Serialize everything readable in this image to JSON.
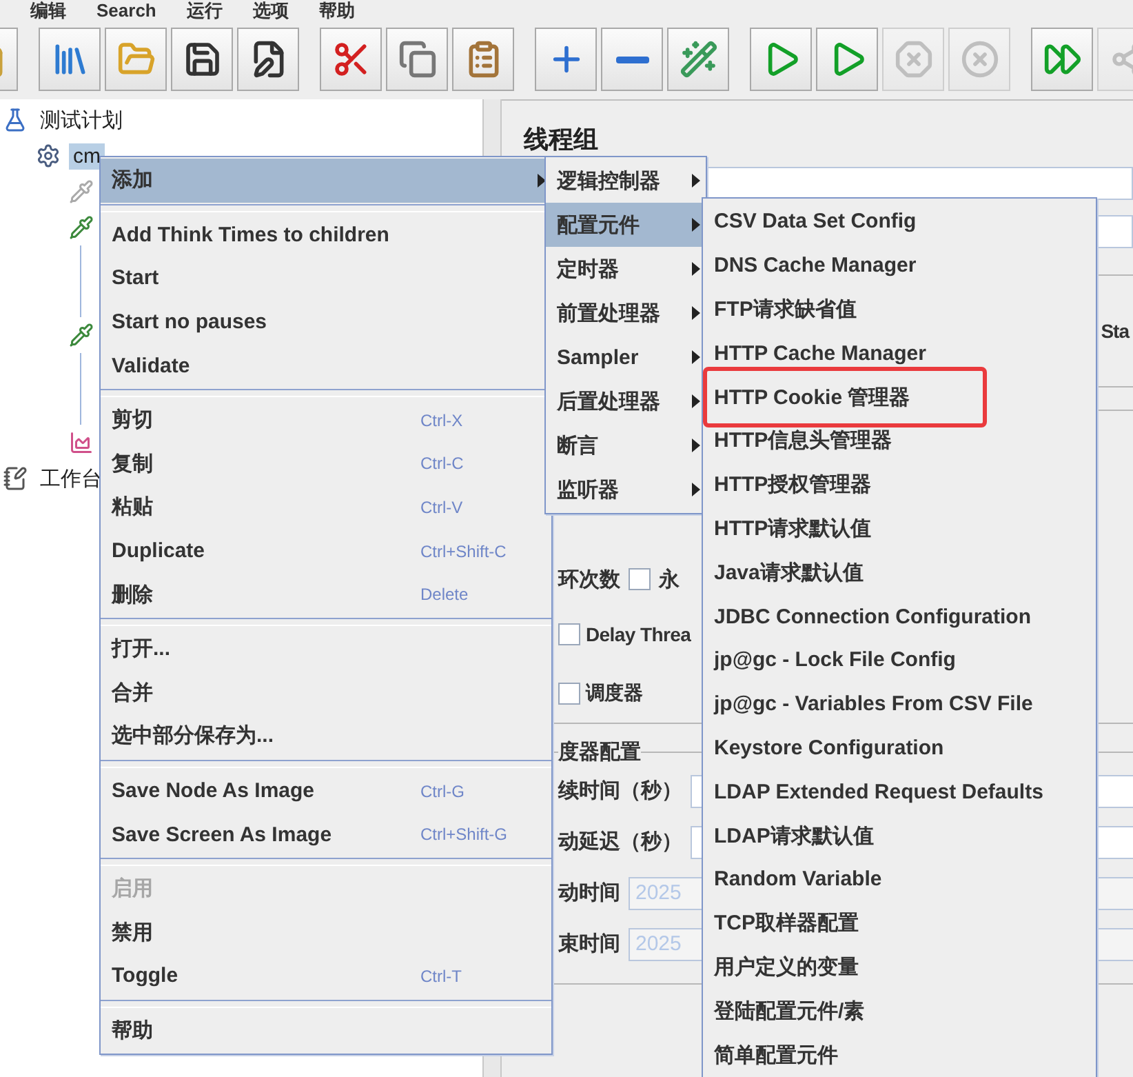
{
  "menubar": [
    "编辑",
    "Search",
    "运行",
    "选项",
    "帮助"
  ],
  "toolbar": [
    [
      {
        "kind": "new",
        "disabled": false
      }
    ],
    [
      {
        "kind": "templates",
        "disabled": false
      },
      {
        "kind": "open",
        "disabled": false
      },
      {
        "kind": "save",
        "disabled": false
      },
      {
        "kind": "save-as",
        "disabled": false
      }
    ],
    [
      {
        "kind": "cut",
        "disabled": false
      },
      {
        "kind": "copy",
        "disabled": false
      },
      {
        "kind": "paste",
        "disabled": false
      }
    ],
    [
      {
        "kind": "expand",
        "disabled": false
      },
      {
        "kind": "collapse",
        "disabled": false
      },
      {
        "kind": "toggle",
        "disabled": false
      }
    ],
    [
      {
        "kind": "start",
        "disabled": false
      },
      {
        "kind": "start-no-pause",
        "disabled": false
      },
      {
        "kind": "stop",
        "disabled": true
      },
      {
        "kind": "shutdown",
        "disabled": true
      }
    ],
    [
      {
        "kind": "remote-start",
        "disabled": false
      },
      {
        "kind": "remote",
        "disabled": true
      }
    ]
  ],
  "tree": [
    {
      "kind": "plan",
      "label": "测试计划",
      "selected": false,
      "children": [
        {
          "kind": "thread-group",
          "label": "cm",
          "selected": true,
          "children": [
            {
              "kind": "sampler",
              "enabled": false
            },
            {
              "kind": "sampler",
              "enabled": true,
              "expanded": true
            },
            {
              "kind": "sampler",
              "enabled": true,
              "expanded": true
            },
            {
              "kind": "listener",
              "enabled": true
            }
          ]
        }
      ]
    },
    {
      "kind": "workbench",
      "label": "工作台",
      "selected": false
    }
  ],
  "panel": {
    "title": "线程组",
    "error_action": "Sta",
    "loop": {
      "label": "环次数",
      "checked": false,
      "forever": "永"
    },
    "options": [
      {
        "label": "Delay Threa",
        "checked": false
      },
      {
        "label": "调度器",
        "checked": false
      }
    ],
    "scheduler": {
      "title": "度器配置",
      "fields": [
        {
          "label": "续时间（秒）"
        },
        {
          "label": "动延迟（秒）"
        },
        {
          "label": "动时间",
          "value": "2025"
        },
        {
          "label": "束时间",
          "value": "2025"
        }
      ]
    }
  },
  "context_menu": [
    [
      {
        "label": "添加",
        "submenu": true,
        "selected": true,
        "disabled": false
      }
    ],
    [
      {
        "label": "Add Think Times to children",
        "selected": false,
        "disabled": false
      },
      {
        "label": "Start",
        "selected": false,
        "disabled": false
      },
      {
        "label": "Start no pauses",
        "selected": false,
        "disabled": false
      },
      {
        "label": "Validate",
        "selected": false,
        "disabled": false
      }
    ],
    [
      {
        "label": "剪切",
        "shortcut": "Ctrl-X",
        "selected": false,
        "disabled": false
      },
      {
        "label": "复制",
        "shortcut": "Ctrl-C",
        "selected": false,
        "disabled": false
      },
      {
        "label": "粘贴",
        "shortcut": "Ctrl-V",
        "selected": false,
        "disabled": false
      },
      {
        "label": "Duplicate",
        "shortcut": "Ctrl+Shift-C",
        "selected": false,
        "disabled": false
      },
      {
        "label": "删除",
        "shortcut": "Delete",
        "selected": false,
        "disabled": false
      }
    ],
    [
      {
        "label": "打开...",
        "selected": false,
        "disabled": false
      },
      {
        "label": "合并",
        "selected": false,
        "disabled": false
      },
      {
        "label": "选中部分保存为...",
        "selected": false,
        "disabled": false
      }
    ],
    [
      {
        "label": "Save Node As Image",
        "shortcut": "Ctrl-G",
        "selected": false,
        "disabled": false
      },
      {
        "label": "Save Screen As Image",
        "shortcut": "Ctrl+Shift-G",
        "selected": false,
        "disabled": false
      }
    ],
    [
      {
        "label": "启用",
        "selected": false,
        "disabled": true
      },
      {
        "label": "禁用",
        "selected": false,
        "disabled": false
      },
      {
        "label": "Toggle",
        "shortcut": "Ctrl-T",
        "selected": false,
        "disabled": false
      }
    ],
    [
      {
        "label": "帮助",
        "selected": false,
        "disabled": false
      }
    ]
  ],
  "add_submenu": [
    {
      "label": "逻辑控制器",
      "selected": false
    },
    {
      "label": "配置元件",
      "selected": true
    },
    {
      "label": "定时器",
      "selected": false
    },
    {
      "label": "前置处理器",
      "selected": false
    },
    {
      "label": "Sampler",
      "selected": false
    },
    {
      "label": "后置处理器",
      "selected": false
    },
    {
      "label": "断言",
      "selected": false
    },
    {
      "label": "监听器",
      "selected": false
    }
  ],
  "config_submenu": [
    {
      "label": "CSV Data Set Config",
      "annotated": false
    },
    {
      "label": "DNS Cache Manager",
      "annotated": false
    },
    {
      "label": "FTP请求缺省值",
      "annotated": false
    },
    {
      "label": "HTTP Cache Manager",
      "annotated": false
    },
    {
      "label": "HTTP Cookie 管理器",
      "annotated": true
    },
    {
      "label": "HTTP信息头管理器",
      "annotated": false
    },
    {
      "label": "HTTP授权管理器",
      "annotated": false
    },
    {
      "label": "HTTP请求默认值",
      "annotated": false
    },
    {
      "label": "Java请求默认值",
      "annotated": false
    },
    {
      "label": "JDBC Connection Configuration",
      "annotated": false
    },
    {
      "label": "jp@gc - Lock File Config",
      "annotated": false
    },
    {
      "label": "jp@gc - Variables From CSV File",
      "annotated": false
    },
    {
      "label": "Keystore Configuration",
      "annotated": false
    },
    {
      "label": "LDAP Extended Request Defaults",
      "annotated": false
    },
    {
      "label": "LDAP请求默认值",
      "annotated": false
    },
    {
      "label": "Random Variable",
      "annotated": false
    },
    {
      "label": "TCP取样器配置",
      "annotated": false
    },
    {
      "label": "用户定义的变量",
      "annotated": false
    },
    {
      "label": "登陆配置元件/素",
      "annotated": false
    },
    {
      "label": "简单配置元件",
      "annotated": false
    }
  ]
}
